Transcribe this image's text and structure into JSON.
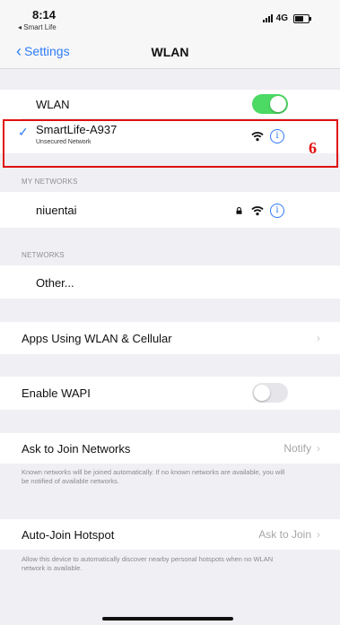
{
  "status_bar": {
    "time": "8:14",
    "back_app": "◂ Smart Life",
    "network": "4G"
  },
  "nav": {
    "back_label": "Settings",
    "title": "WLAN"
  },
  "wlan_toggle": {
    "label": "WLAN",
    "state": "on"
  },
  "connected_network": {
    "name": "SmartLife-A937",
    "subtitle": "Unsecured Network"
  },
  "my_networks": {
    "header": "MY NETWORKS",
    "items": [
      {
        "name": "niuentai",
        "secured": true
      }
    ]
  },
  "networks": {
    "header": "NETWORKS",
    "other_label": "Other..."
  },
  "apps_using": {
    "label": "Apps Using WLAN & Cellular"
  },
  "wapi": {
    "label": "Enable WAPI",
    "state": "off"
  },
  "ask_to_join": {
    "label": "Ask to Join Networks",
    "value": "Notify",
    "footnote": "Known networks will be joined automatically. If no known networks are available, you will be notified of available networks."
  },
  "auto_join": {
    "label": "Auto-Join Hotspot",
    "value": "Ask to Join",
    "footnote": "Allow this device to automatically discover nearby personal hotspots when no WLAN network is available."
  },
  "annotation": {
    "step_number": "6"
  },
  "colors": {
    "accent": "#2f7cf6",
    "toggle_on": "#4cd964",
    "annotation": "#e01010"
  }
}
